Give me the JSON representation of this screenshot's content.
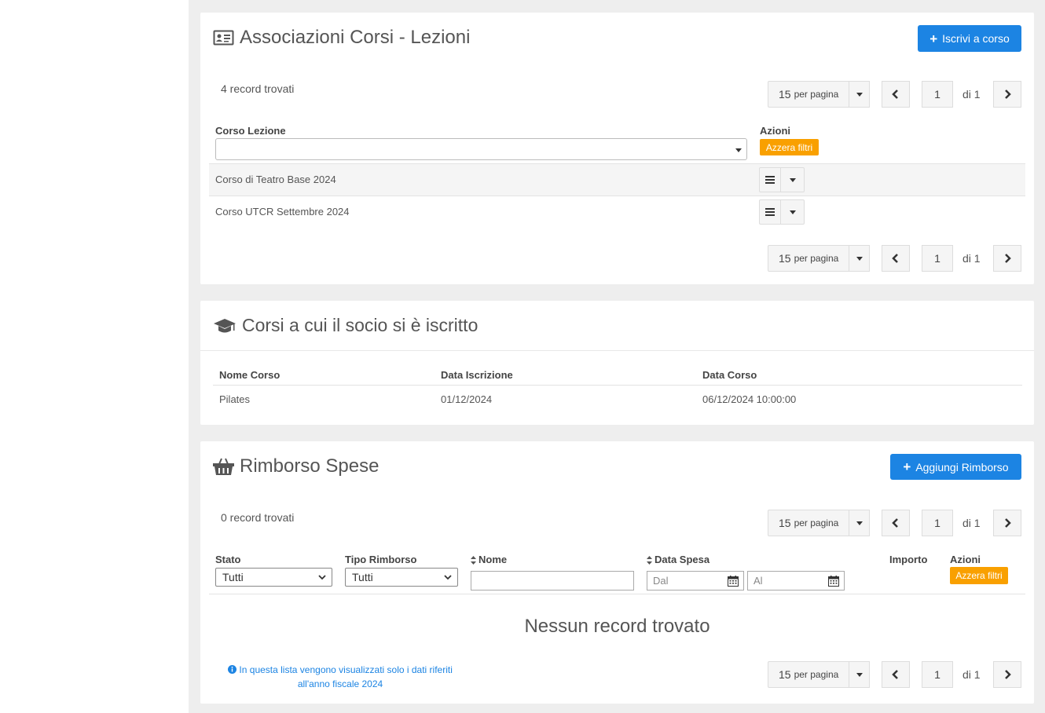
{
  "panel1": {
    "title": "Associazioni Corsi - Lezioni",
    "add_button": "Iscrivi a corso",
    "records": "4 record trovati",
    "pager": {
      "per_page": "15",
      "per_page_suffix": "per pagina",
      "page": "1",
      "total": "di 1"
    },
    "col_corso": "Corso Lezione",
    "col_azioni": "Azioni",
    "reset_filters": "Azzera filtri",
    "filter_value": "",
    "rows": [
      {
        "label": "Corso di Teatro Base 2024"
      },
      {
        "label": "Corso UTCR Settembre 2024"
      }
    ]
  },
  "panel2": {
    "title": "Corsi a cui il socio si è iscritto",
    "columns": [
      "Nome Corso",
      "Data Iscrizione",
      "Data Corso"
    ],
    "rows": [
      {
        "nome": "Pilates",
        "iscrizione": "01/12/2024",
        "corso": "06/12/2024 10:00:00"
      }
    ]
  },
  "panel3": {
    "title": "Rimborso Spese",
    "add_button": "Aggiungi Rimborso",
    "records": "0 record trovati",
    "pager": {
      "per_page": "15",
      "per_page_suffix": "per pagina",
      "page": "1",
      "total": "di 1"
    },
    "col_stato": "Stato",
    "col_tipo": "Tipo Rimborso",
    "col_nome": "Nome",
    "col_data": "Data Spesa",
    "col_importo": "Importo",
    "col_azioni": "Azioni",
    "stato_value": "Tutti",
    "tipo_value": "Tutti",
    "nome_value": "",
    "dal_placeholder": "Dal",
    "al_placeholder": "Al",
    "reset_filters": "Azzera filtri",
    "empty": "Nessun record trovato",
    "note_line1": "In questa lista vengono visualizzati solo i dati riferiti",
    "note_line2": "all'anno fiscale 2024"
  },
  "colors": {
    "primary": "#1c84e3",
    "warning": "#f9a000",
    "background": "#eeeeee",
    "info": "#1c84e3"
  },
  "icons": [
    "id-card-icon",
    "graduation-cap-icon",
    "basket-icon",
    "plus-icon",
    "chevron-left-icon",
    "chevron-right-icon",
    "caret-down-icon",
    "bars-icon",
    "calendar-icon",
    "sort-icon",
    "info-circle-icon"
  ]
}
